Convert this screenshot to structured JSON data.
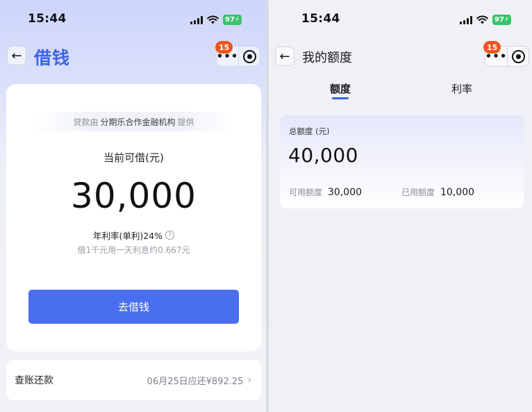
{
  "left": {
    "status": {
      "time": "15:44",
      "battery": "97"
    },
    "nav": {
      "back": "←",
      "title": "借钱",
      "more": "•••",
      "badge": "15"
    },
    "card": {
      "provider_prefix": "贷款由",
      "provider_name": "分期乐合作金融机构",
      "provider_suffix": "提供",
      "available_label": "当前可借(元)",
      "available_amount": "30,000",
      "rate_text": "年利率(单利)24%",
      "help": "?",
      "interest_text": "借1千元用一天利息约0.667元",
      "borrow_button": "去借钱"
    },
    "repay": {
      "label": "查账还款",
      "due_text": "06月25日应还¥892.25",
      "chevron": "›"
    }
  },
  "right": {
    "status": {
      "time": "15:44",
      "battery": "97"
    },
    "nav": {
      "back": "←",
      "title": "我的额度",
      "more": "•••",
      "badge": "15"
    },
    "tabs": [
      {
        "label": "额度",
        "active": true
      },
      {
        "label": "利率",
        "active": false
      }
    ],
    "quota": {
      "total_label": "总额度 (元)",
      "total_amount": "40,000",
      "available_label": "可用额度",
      "available_value": "30,000",
      "used_label": "已用额度",
      "used_value": "10,000"
    }
  },
  "colors": {
    "accent": "#3a63e8",
    "button": "#4a6ef0",
    "badge": "#f0551b",
    "battery": "#38c36b"
  }
}
